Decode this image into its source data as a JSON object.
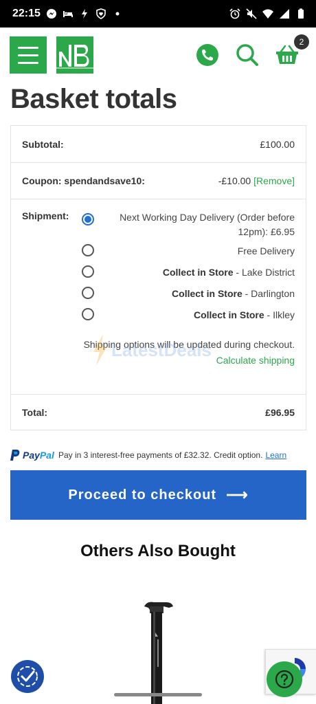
{
  "status_bar": {
    "time": "22:15",
    "left_icons": [
      "messenger-icon",
      "bed-icon",
      "bolt-icon",
      "shield-heart-icon",
      "dot-icon"
    ],
    "right_icons": [
      "alarm-icon",
      "mute-icon",
      "wifi-icon",
      "signal-icon",
      "battery-icon"
    ]
  },
  "header": {
    "logo_text": "NB",
    "cart_count": "2",
    "brand_color": "#2ba84a"
  },
  "page_title": "Basket totals",
  "totals": {
    "subtotal_label": "Subtotal:",
    "subtotal_value": "£100.00",
    "coupon_label": "Coupon: spendandsave10:",
    "coupon_value": "-£10.00",
    "coupon_remove": "[Remove]",
    "shipment_label": "Shipment:",
    "shipping_options": [
      {
        "text": "Next Working Day Delivery (Order before 12pm): £6.95",
        "selected": true
      },
      {
        "bold": "",
        "text": "Free Delivery",
        "selected": false
      },
      {
        "bold": "Collect in Store",
        "text": " - Lake District",
        "selected": false
      },
      {
        "bold": "Collect in Store",
        "text": " - Darlington",
        "selected": false
      },
      {
        "bold": "Collect in Store",
        "text": " - Ilkley",
        "selected": false
      }
    ],
    "shipping_note": "Shipping options will be updated during checkout.",
    "calculate_shipping": "Calculate shipping",
    "total_label": "Total:",
    "total_value": "£96.95"
  },
  "paypal": {
    "brand_pay": "Pay",
    "brand_pal": "Pal",
    "message": "Pay in 3 interest-free payments of £32.32. Credit option.",
    "learn": "Learn"
  },
  "checkout_label": "Proceed to checkout",
  "checkout_arrow": "⟶",
  "others_title": "Others Also Bought",
  "watermark": "LatestDeals"
}
